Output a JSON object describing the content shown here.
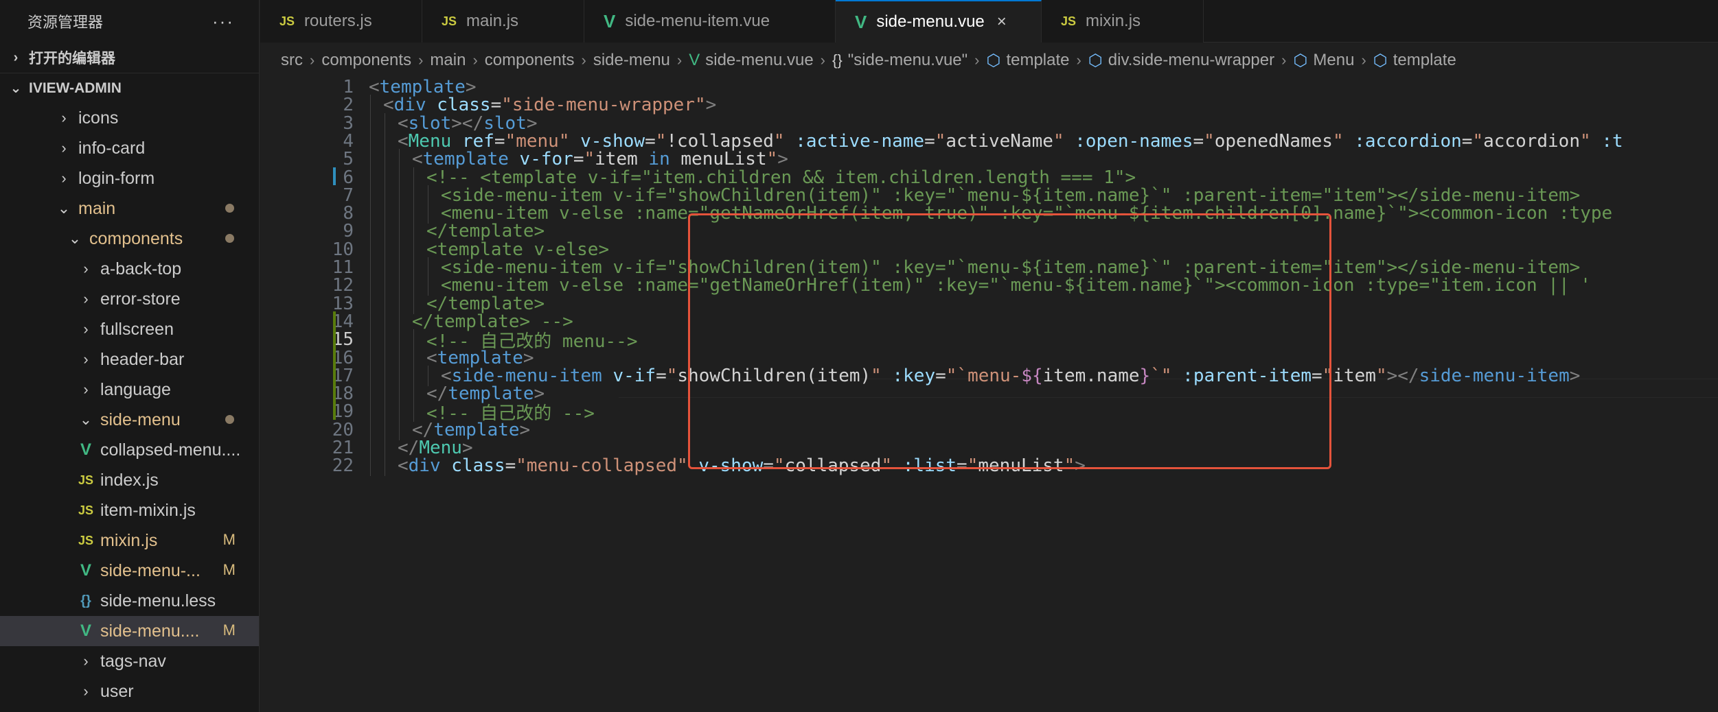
{
  "sidebar": {
    "title": "资源管理器",
    "more_icon": "ellipsis-icon",
    "open_editors": "打开的编辑器",
    "project": "IVIEW-ADMIN",
    "tree": [
      {
        "label": "icons",
        "type": "folder",
        "expanded": false,
        "modified": false
      },
      {
        "label": "info-card",
        "type": "folder",
        "expanded": false,
        "modified": false
      },
      {
        "label": "login-form",
        "type": "folder",
        "expanded": false,
        "modified": false
      },
      {
        "label": "main",
        "type": "folder",
        "expanded": true,
        "modified": true
      },
      {
        "label": "components",
        "type": "folder",
        "expanded": true,
        "modified": true
      },
      {
        "label": "a-back-top",
        "type": "folder",
        "expanded": false,
        "modified": false
      },
      {
        "label": "error-store",
        "type": "folder",
        "expanded": false,
        "modified": false
      },
      {
        "label": "fullscreen",
        "type": "folder",
        "expanded": false,
        "modified": false
      },
      {
        "label": "header-bar",
        "type": "folder",
        "expanded": false,
        "modified": false
      },
      {
        "label": "language",
        "type": "folder",
        "expanded": false,
        "modified": false
      },
      {
        "label": "side-menu",
        "type": "folder",
        "expanded": true,
        "modified": true
      },
      {
        "label": "collapsed-menu....",
        "type": "vue",
        "modified": false,
        "badge": ""
      },
      {
        "label": "index.js",
        "type": "js",
        "modified": false,
        "badge": ""
      },
      {
        "label": "item-mixin.js",
        "type": "js",
        "modified": false,
        "badge": ""
      },
      {
        "label": "mixin.js",
        "type": "js",
        "modified": true,
        "badge": "M"
      },
      {
        "label": "side-menu-...",
        "type": "vue",
        "modified": true,
        "badge": "M"
      },
      {
        "label": "side-menu.less",
        "type": "less",
        "modified": false,
        "badge": ""
      },
      {
        "label": "side-menu....",
        "type": "vue",
        "modified": true,
        "badge": "M",
        "selected": true
      },
      {
        "label": "tags-nav",
        "type": "folder",
        "expanded": false,
        "modified": false
      },
      {
        "label": "user",
        "type": "folder",
        "expanded": false,
        "modified": false
      }
    ]
  },
  "tabs": [
    {
      "label": "routers.js",
      "icon": "JS",
      "type": "js",
      "active": false
    },
    {
      "label": "main.js",
      "icon": "JS",
      "type": "js",
      "active": false
    },
    {
      "label": "side-menu-item.vue",
      "icon": "V",
      "type": "vue",
      "active": false
    },
    {
      "label": "side-menu.vue",
      "icon": "V",
      "type": "vue",
      "active": true,
      "close": "×"
    },
    {
      "label": "mixin.js",
      "icon": "JS",
      "type": "js",
      "active": false
    }
  ],
  "breadcrumb": [
    {
      "label": "src",
      "icon": ""
    },
    {
      "label": "components",
      "icon": ""
    },
    {
      "label": "main",
      "icon": ""
    },
    {
      "label": "components",
      "icon": ""
    },
    {
      "label": "side-menu",
      "icon": ""
    },
    {
      "label": "side-menu.vue",
      "icon": "vue"
    },
    {
      "label": "\"side-menu.vue\"",
      "icon": "braces"
    },
    {
      "label": "template",
      "icon": "cube"
    },
    {
      "label": "div.side-menu-wrapper",
      "icon": "cube"
    },
    {
      "label": "Menu",
      "icon": "cube"
    },
    {
      "label": "template",
      "icon": "cube"
    }
  ],
  "editor": {
    "colors": {
      "highlight_box": "#e5533b",
      "gutter_modified": "#2f8fbd",
      "gutter_added": "#587c0c"
    },
    "lines": [
      {
        "n": "1",
        "indent": 0,
        "tokens": [
          [
            "b",
            "<"
          ],
          [
            "tag",
            "template"
          ],
          [
            "b",
            ">"
          ]
        ]
      },
      {
        "n": "2",
        "indent": 1,
        "tokens": [
          [
            "b",
            "<"
          ],
          [
            "tag",
            "div"
          ],
          [
            "p",
            " "
          ],
          [
            "attr",
            "class"
          ],
          [
            "p",
            "="
          ],
          [
            "str",
            "\"side-menu-wrapper\""
          ],
          [
            "b",
            ">"
          ]
        ]
      },
      {
        "n": "3",
        "indent": 2,
        "tokens": [
          [
            "b",
            "<"
          ],
          [
            "tag",
            "slot"
          ],
          [
            "b",
            "></"
          ],
          [
            "tag",
            "slot"
          ],
          [
            "b",
            ">"
          ]
        ]
      },
      {
        "n": "4",
        "indent": 2,
        "tokens": [
          [
            "b",
            "<"
          ],
          [
            "comp",
            "Menu"
          ],
          [
            "p",
            " "
          ],
          [
            "attr",
            "ref"
          ],
          [
            "p",
            "="
          ],
          [
            "str",
            "\"menu\""
          ],
          [
            "p",
            " "
          ],
          [
            "attr",
            "v-show"
          ],
          [
            "p",
            "="
          ],
          [
            "str",
            "\""
          ],
          [
            "p",
            "!collapsed"
          ],
          [
            "str",
            "\""
          ],
          [
            "p",
            " "
          ],
          [
            "attr",
            ":active-name"
          ],
          [
            "p",
            "="
          ],
          [
            "str",
            "\""
          ],
          [
            "p",
            "activeName"
          ],
          [
            "str",
            "\""
          ],
          [
            "p",
            " "
          ],
          [
            "attr",
            ":open-names"
          ],
          [
            "p",
            "="
          ],
          [
            "str",
            "\""
          ],
          [
            "p",
            "openedNames"
          ],
          [
            "str",
            "\""
          ],
          [
            "p",
            " "
          ],
          [
            "attr",
            ":accordion"
          ],
          [
            "p",
            "="
          ],
          [
            "str",
            "\""
          ],
          [
            "p",
            "accordion"
          ],
          [
            "str",
            "\""
          ],
          [
            "p",
            " "
          ],
          [
            "attr",
            ":t"
          ]
        ]
      },
      {
        "n": "5",
        "indent": 3,
        "tokens": [
          [
            "b",
            "<"
          ],
          [
            "tag",
            "template"
          ],
          [
            "p",
            " "
          ],
          [
            "attr",
            "v-for"
          ],
          [
            "p",
            "="
          ],
          [
            "str",
            "\""
          ],
          [
            "p",
            "item "
          ],
          [
            "tag",
            "in"
          ],
          [
            "p",
            " menuList"
          ],
          [
            "str",
            "\""
          ],
          [
            "b",
            ">"
          ]
        ]
      },
      {
        "n": "6",
        "indent": 4,
        "tokens": [
          [
            "c",
            "<!-- <template v-if=\"item.children && item.children.length === 1\">"
          ]
        ]
      },
      {
        "n": "7",
        "indent": 5,
        "tokens": [
          [
            "c",
            "<side-menu-item v-if=\"showChildren(item)\" :key=\"`menu-${item.name}`\" :parent-item=\"item\"></side-menu-item>"
          ]
        ]
      },
      {
        "n": "8",
        "indent": 5,
        "tokens": [
          [
            "c",
            "<menu-item v-else :name=\"getNameOrHref(item, true)\" :key=\"`menu-${item.children[0].name}`\"><common-icon :type"
          ]
        ]
      },
      {
        "n": "9",
        "indent": 4,
        "tokens": [
          [
            "c",
            "</template>"
          ]
        ]
      },
      {
        "n": "10",
        "indent": 4,
        "tokens": [
          [
            "c",
            "<template v-else>"
          ]
        ]
      },
      {
        "n": "11",
        "indent": 5,
        "tokens": [
          [
            "c",
            "<side-menu-item v-if=\"showChildren(item)\" :key=\"`menu-${item.name}`\" :parent-item=\"item\"></side-menu-item>"
          ]
        ]
      },
      {
        "n": "12",
        "indent": 5,
        "tokens": [
          [
            "c",
            "<menu-item v-else :name=\"getNameOrHref(item)\" :key=\"`menu-${item.name}`\"><common-icon :type=\"item.icon || '"
          ]
        ]
      },
      {
        "n": "13",
        "indent": 4,
        "tokens": [
          [
            "c",
            "</template>"
          ]
        ]
      },
      {
        "n": "14",
        "indent": 3,
        "tokens": [
          [
            "c",
            "</template> -->"
          ]
        ]
      },
      {
        "n": "15",
        "indent": 4,
        "tokens": [
          [
            "c",
            "<!-- 自己改的 menu-->"
          ]
        ]
      },
      {
        "n": "16",
        "indent": 4,
        "tokens": [
          [
            "b",
            "<"
          ],
          [
            "tag",
            "template"
          ],
          [
            "b",
            ">"
          ]
        ]
      },
      {
        "n": "17",
        "indent": 5,
        "tokens": [
          [
            "b",
            "<"
          ],
          [
            "tag",
            "side-menu-item"
          ],
          [
            "p",
            " "
          ],
          [
            "attr",
            "v-if"
          ],
          [
            "p",
            "="
          ],
          [
            "str",
            "\""
          ],
          [
            "p",
            "showChildren(item)"
          ],
          [
            "str",
            "\""
          ],
          [
            "p",
            " "
          ],
          [
            "attr",
            ":key"
          ],
          [
            "p",
            "="
          ],
          [
            "str",
            "\"`menu-"
          ],
          [
            "kw",
            "${"
          ],
          [
            "p",
            "item.name"
          ],
          [
            "kw",
            "}"
          ],
          [
            "str",
            "`\""
          ],
          [
            "p",
            " "
          ],
          [
            "attr",
            ":parent-item"
          ],
          [
            "p",
            "="
          ],
          [
            "str",
            "\""
          ],
          [
            "p",
            "item"
          ],
          [
            "str",
            "\""
          ],
          [
            "b",
            "></"
          ],
          [
            "tag",
            "side-menu-item"
          ],
          [
            "b",
            ">"
          ]
        ]
      },
      {
        "n": "18",
        "indent": 4,
        "tokens": [
          [
            "b",
            "</"
          ],
          [
            "tag",
            "template"
          ],
          [
            "b",
            ">"
          ]
        ]
      },
      {
        "n": "19",
        "indent": 4,
        "tokens": [
          [
            "c",
            "<!-- 自己改的 -->"
          ]
        ]
      },
      {
        "n": "20",
        "indent": 3,
        "tokens": [
          [
            "b",
            "</"
          ],
          [
            "tag",
            "template"
          ],
          [
            "b",
            ">"
          ]
        ]
      },
      {
        "n": "21",
        "indent": 2,
        "tokens": [
          [
            "b",
            "</"
          ],
          [
            "comp",
            "Menu"
          ],
          [
            "b",
            ">"
          ]
        ]
      },
      {
        "n": "22",
        "indent": 2,
        "tokens": [
          [
            "b",
            "<"
          ],
          [
            "tag",
            "div"
          ],
          [
            "p",
            " "
          ],
          [
            "attr",
            "class"
          ],
          [
            "p",
            "="
          ],
          [
            "str",
            "\"menu-collapsed\""
          ],
          [
            "p",
            " "
          ],
          [
            "attr",
            "v-show"
          ],
          [
            "p",
            "="
          ],
          [
            "str",
            "\""
          ],
          [
            "p",
            "collapsed"
          ],
          [
            "str",
            "\""
          ],
          [
            "p",
            " "
          ],
          [
            "attr",
            ":list"
          ],
          [
            "p",
            "="
          ],
          [
            "str",
            "\""
          ],
          [
            "p",
            "menuList"
          ],
          [
            "str",
            "\""
          ],
          [
            "b",
            ">"
          ]
        ]
      }
    ]
  }
}
